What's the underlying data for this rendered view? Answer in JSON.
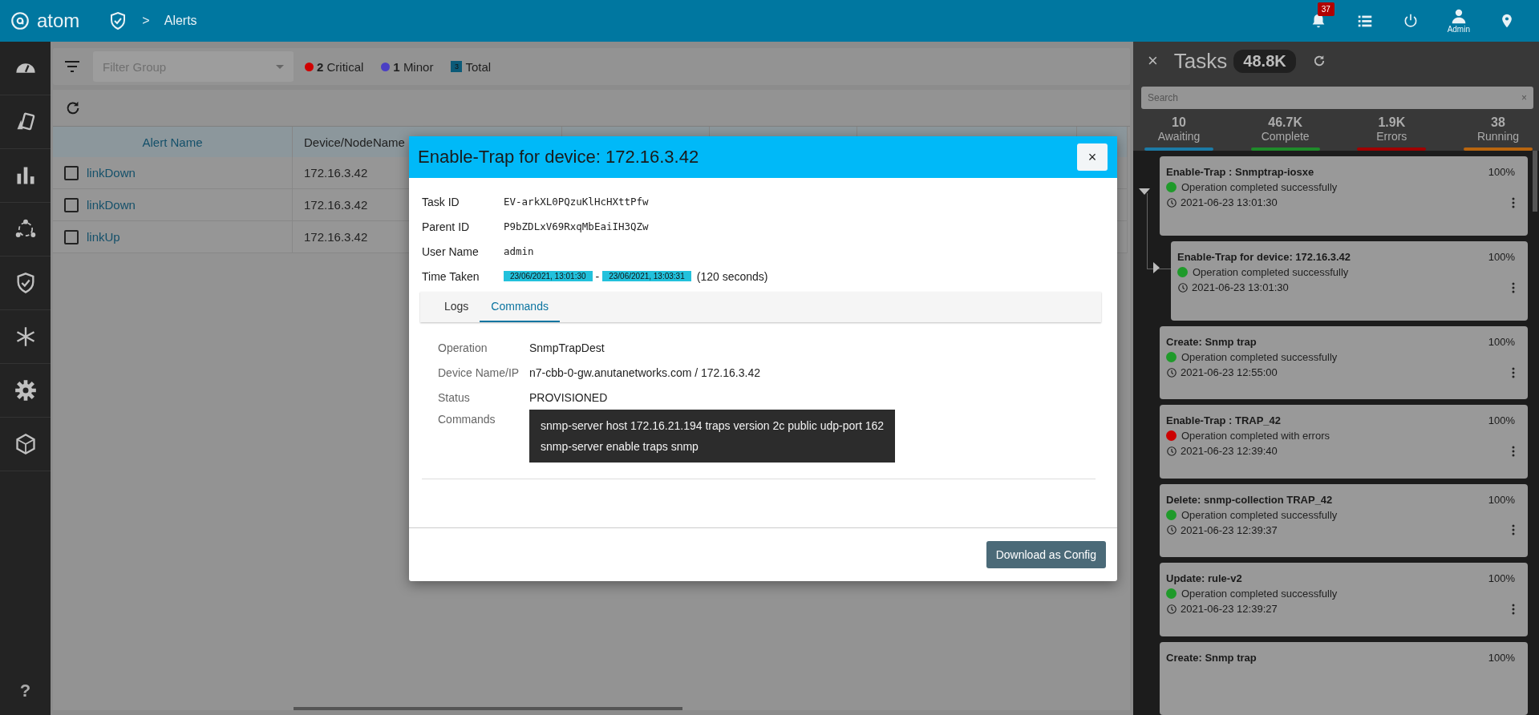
{
  "topbar": {
    "logo": "atom",
    "separator": ">",
    "breadcrumb": "Alerts",
    "notification_count": "37",
    "user": "Admin"
  },
  "sidebar": {
    "help": "?"
  },
  "filter_bar": {
    "placeholder": "Filter Group",
    "counts": [
      {
        "kind": "dot",
        "count": "2",
        "label": "Critical",
        "color": "#d00000"
      },
      {
        "kind": "dot",
        "count": "1",
        "label": "Minor",
        "color": "#4b3fc4"
      },
      {
        "kind": "square",
        "count": "3",
        "label": "Total",
        "color": "#0b5a78"
      }
    ]
  },
  "table": {
    "columns": [
      "Alert Name",
      "Device/NodeName"
    ],
    "rows": [
      {
        "alert_name": "linkDown",
        "device": "172.16.3.42",
        "checked": false
      },
      {
        "alert_name": "linkDown",
        "device": "172.16.3.42",
        "checked": false
      },
      {
        "alert_name": "linkUp",
        "device": "172.16.3.42",
        "checked": false
      }
    ]
  },
  "modal": {
    "title": "Enable-Trap for device: 172.16.3.42",
    "close": "×",
    "fields": [
      {
        "label": "Task ID",
        "value": "EV-arkXL0PQzuKlHcHXttPfw"
      },
      {
        "label": "Parent ID",
        "value": "P9bZDLxV69RxqMbEaiIH3QZw"
      },
      {
        "label": "User Name",
        "value": "admin"
      }
    ],
    "time_taken": {
      "label": "Time Taken",
      "start": "23/06/2021, 13:01:30",
      "separator": "-",
      "end": "23/06/2021, 13:03:31",
      "duration": "(120 seconds)"
    },
    "tabs": [
      {
        "label": "Logs",
        "selected": false
      },
      {
        "label": "Commands",
        "selected": true
      }
    ],
    "details": [
      {
        "label": "Operation",
        "value": "SnmpTrapDest"
      },
      {
        "label": "Device Name/IP",
        "value": "n7-cbb-0-gw.anutanetworks.com / 172.16.3.42"
      },
      {
        "label": "Status",
        "value": "PROVISIONED"
      }
    ],
    "commands_label": "Commands",
    "commands": [
      "snmp-server host 172.16.21.194 traps version 2c public udp-port 162",
      "snmp-server enable traps snmp"
    ],
    "button": "Download as Config"
  },
  "tasks": {
    "close": "×",
    "title": "Tasks",
    "count": "48.8K",
    "search_placeholder": "Search",
    "search_clear": "×",
    "stats": [
      {
        "value": "10",
        "label": "Awaiting",
        "color": "#1c7aa6"
      },
      {
        "value": "46.7K",
        "label": "Complete",
        "color": "#1f8a2a"
      },
      {
        "value": "1.9K",
        "label": "Errors",
        "color": "#a00000"
      },
      {
        "value": "38",
        "label": "Running",
        "color": "#b8650f"
      }
    ],
    "items": [
      {
        "title": "Enable-Trap : Snmptrap-iosxe",
        "percent": "100%",
        "status": "Operation completed successfully",
        "color": "#1f9a2a",
        "time": "2021-06-23 13:01:30",
        "expanded": true,
        "children": [
          {
            "title": "Enable-Trap for device: 172.16.3.42",
            "percent": "100%",
            "status": "Operation completed successfully",
            "color": "#1f9a2a",
            "time": "2021-06-23 13:01:30",
            "expanded": false
          }
        ]
      },
      {
        "title": "Create: Snmp trap",
        "percent": "100%",
        "status": "Operation completed successfully",
        "color": "#1f9a2a",
        "time": "2021-06-23 12:55:00"
      },
      {
        "title": "Enable-Trap : TRAP_42",
        "percent": "100%",
        "status": "Operation completed with errors",
        "color": "#cc0000",
        "time": "2021-06-23 12:39:40"
      },
      {
        "title": "Delete: snmp-collection TRAP_42",
        "percent": "100%",
        "status": "Operation completed successfully",
        "color": "#1f9a2a",
        "time": "2021-06-23 12:39:37"
      },
      {
        "title": "Update: rule-v2",
        "percent": "100%",
        "status": "Operation completed successfully",
        "color": "#1f9a2a",
        "time": "2021-06-23 12:39:27"
      },
      {
        "title": "Create: Snmp trap",
        "percent": "100%"
      }
    ]
  }
}
